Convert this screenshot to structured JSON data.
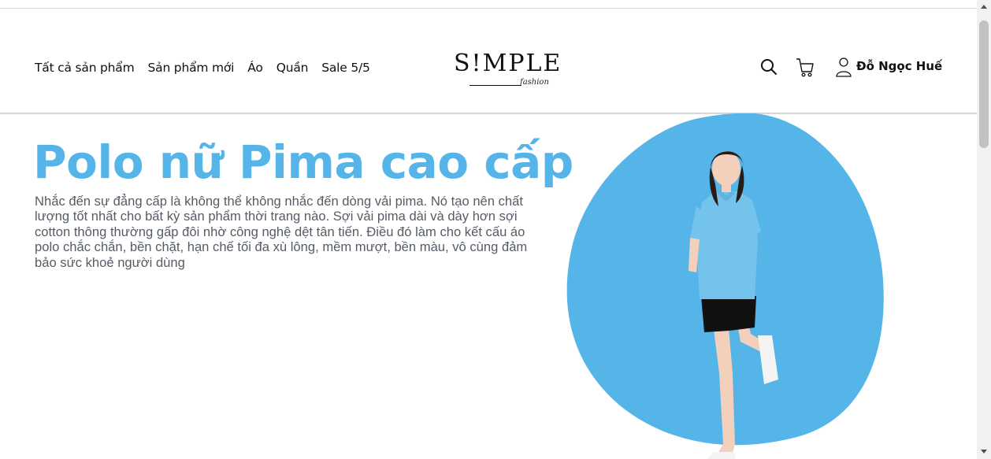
{
  "header": {
    "nav": [
      {
        "label": "Tất cả sản phẩm"
      },
      {
        "label": "Sản phẩm mới"
      },
      {
        "label": "Áo"
      },
      {
        "label": "Quần"
      },
      {
        "label": "Sale 5/5"
      }
    ],
    "logo": {
      "main": "S!MPLE",
      "sub": "fashion"
    },
    "icons": [
      "search-icon",
      "cart-icon",
      "user-icon"
    ],
    "user_name": "Đỗ Ngọc Huế"
  },
  "hero": {
    "title": "Polo nữ Pima cao cấp",
    "description": "Nhắc đến sự đẳng cấp là không thể không nhắc đến dòng vải pima. Nó tạo nên chất lượng tốt nhất cho bất kỳ sản phẩm thời trang nào. Sợi vải pima dài và dày hơn sợi cotton thông thường gấp đôi nhờ công nghệ dệt tân tiến. Điều đó làm cho kết cấu áo polo chắc chắn, bền chặt, hạn chế tối đa xù lông, mềm mượt, bền màu, vô cùng đảm bảo sức khoẻ người dùng",
    "accent_color": "#56b5e8",
    "shirt_color": "#74c3ec",
    "shorts_color": "#111111"
  }
}
